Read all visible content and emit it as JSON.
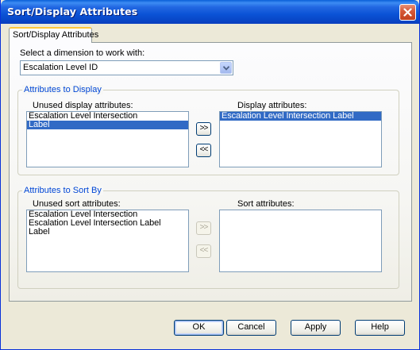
{
  "window": {
    "title": "Sort/Display Attributes",
    "close_icon": "close-icon"
  },
  "tab": {
    "label": "Sort/Display Attributes"
  },
  "dimension": {
    "label": "Select a dimension to work with:",
    "selected": "Escalation Level ID"
  },
  "display_group": {
    "title": "Attributes to Display",
    "unused_label": "Unused display attributes:",
    "display_label": "Display attributes:",
    "unused_items": [
      {
        "text": "Escalation Level Intersection",
        "selected": false
      },
      {
        "text": "Label",
        "selected": true
      }
    ],
    "display_items": [
      {
        "text": "Escalation Level Intersection Label",
        "selected": true
      }
    ],
    "add_label": ">>",
    "remove_label": "<<"
  },
  "sort_group": {
    "title": "Attributes to Sort By",
    "unused_label": "Unused sort attributes:",
    "sort_label": "Sort attributes:",
    "unused_items": [
      {
        "text": "Escalation Level Intersection",
        "selected": false
      },
      {
        "text": "Escalation Level Intersection Label",
        "selected": false
      },
      {
        "text": "Label",
        "selected": false
      }
    ],
    "sort_items": [],
    "add_label": ">>",
    "remove_label": "<<"
  },
  "buttons": {
    "ok": "OK",
    "cancel": "Cancel",
    "apply": "Apply",
    "help": "Help"
  },
  "colors": {
    "titlebar": "#0a4fd0",
    "selection": "#316ac5",
    "group_title": "#0046d5",
    "dialog_bg": "#ece9d8"
  }
}
